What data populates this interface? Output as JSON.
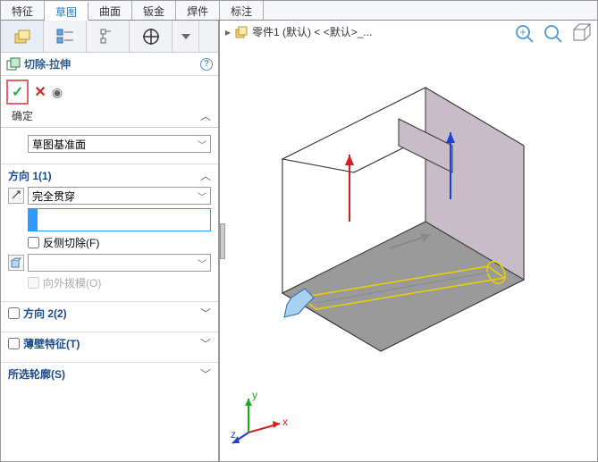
{
  "tabs": {
    "t0": "特征",
    "t1": "草图",
    "t2": "曲面",
    "t3": "钣金",
    "t4": "焊件",
    "t5": "标注"
  },
  "feature": {
    "title": "切除-拉伸"
  },
  "confirm": {
    "label": "确定"
  },
  "from_section": {
    "plane": "草图基准面"
  },
  "dir1": {
    "title": "方向 1(1)",
    "endcond": "完全贯穿",
    "flip_check": "反侧切除(F)",
    "draft_check": "向外拨模(O)"
  },
  "dir2": {
    "title": "方向 2(2)"
  },
  "thin": {
    "title": "薄壁特征(T)"
  },
  "contour": {
    "title": "所选轮廓(S)"
  },
  "breadcrumb": {
    "part": "零件1 (默认) < <默认>_..."
  },
  "triad": {
    "x": "x",
    "y": "y",
    "z": "z"
  }
}
